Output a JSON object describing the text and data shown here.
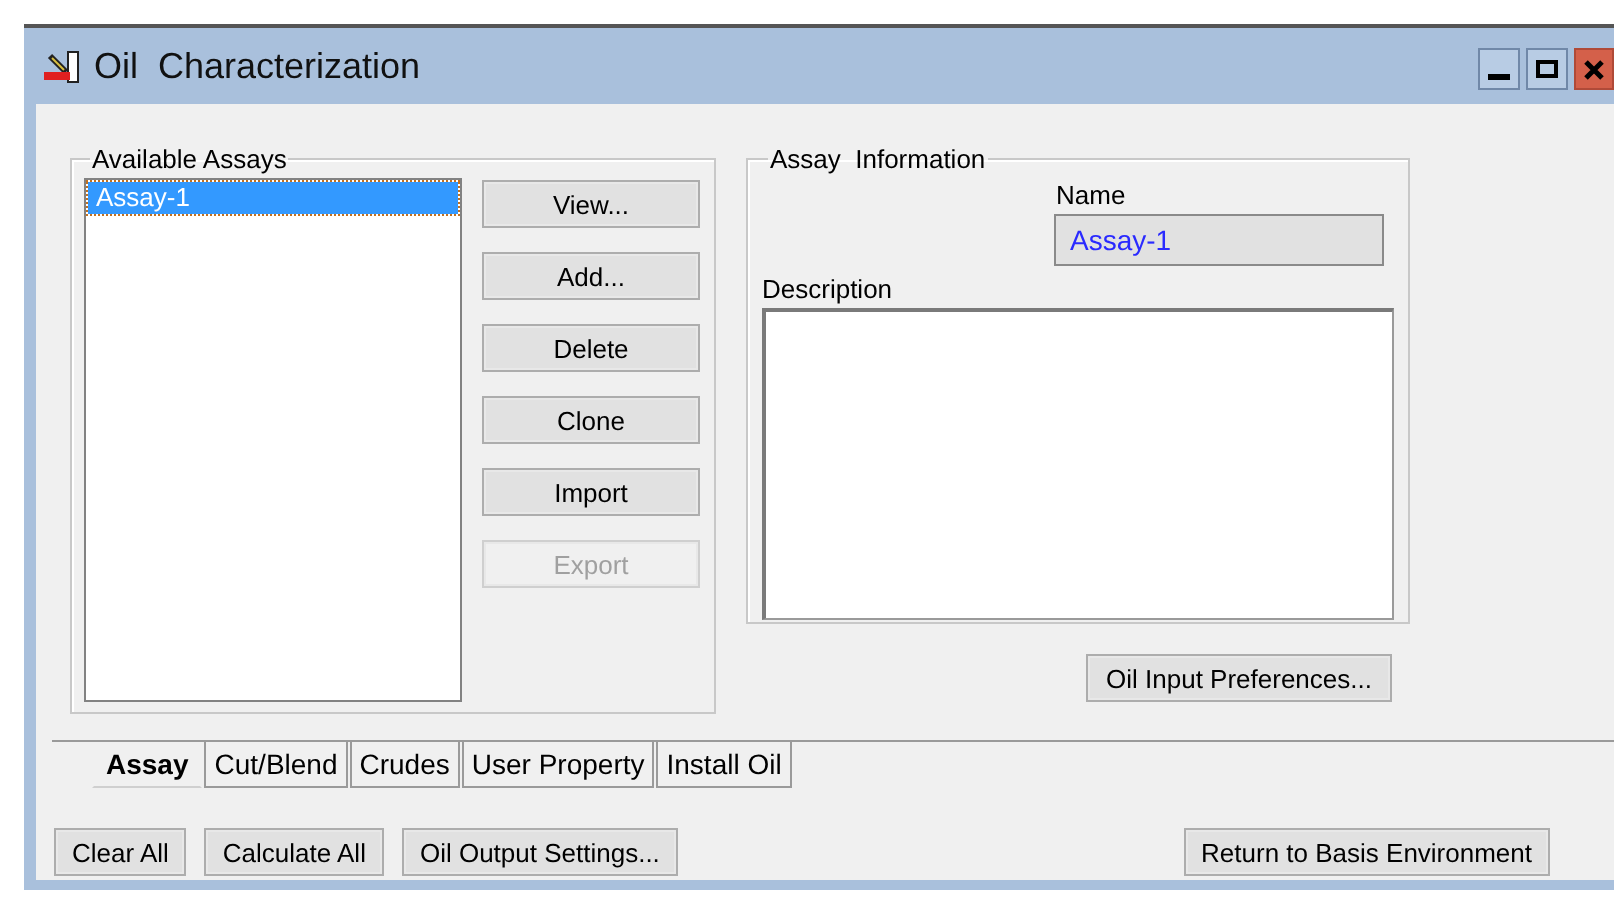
{
  "window": {
    "title": "Oil  Characterization"
  },
  "available_assays": {
    "label": "Available Assays",
    "items": [
      {
        "text": "Assay-1",
        "selected": true
      }
    ]
  },
  "assay_buttons": [
    {
      "label": "View...",
      "disabled": false
    },
    {
      "label": "Add...",
      "disabled": false
    },
    {
      "label": "Delete",
      "disabled": false
    },
    {
      "label": "Clone",
      "disabled": false
    },
    {
      "label": "Import",
      "disabled": false
    },
    {
      "label": "Export",
      "disabled": true
    }
  ],
  "assay_information": {
    "label": "Assay  Information",
    "name_label": "Name",
    "name_value": "Assay-1",
    "description_label": "Description"
  },
  "preferences_button": "Oil Input Preferences...",
  "tabs": [
    {
      "label": "Assay",
      "selected": true
    },
    {
      "label": "Cut/Blend",
      "selected": false
    },
    {
      "label": "Crudes",
      "selected": false
    },
    {
      "label": "User Property",
      "selected": false
    },
    {
      "label": "Install Oil",
      "selected": false
    }
  ],
  "bottom_buttons": [
    "Clear All",
    "Calculate All",
    "Oil Output Settings..."
  ],
  "return_button": "Return to Basis Environment"
}
